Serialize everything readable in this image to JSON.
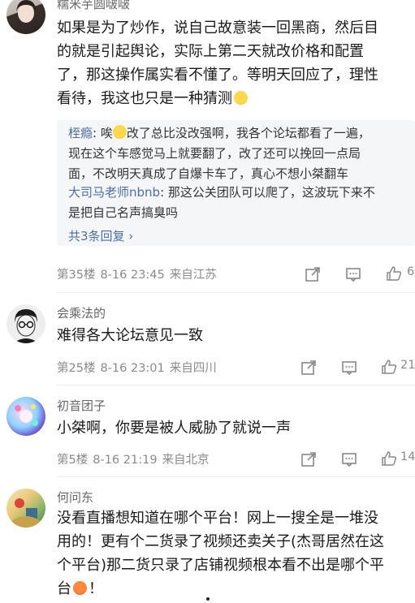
{
  "comments": [
    {
      "username": "糯米芋圆啵啵",
      "body_lines": [
        "如果是为了炒作，说自己故意装一回黑商，然后目",
        "的就是引起舆论，实际上第二天就改价格和配置",
        "了，那这操作属实看不懂了。等明天回应了，理性",
        "看待，我这也只是一种猜测"
      ],
      "replies": [
        {
          "name": "桎瘾",
          "sep": ": ",
          "lines": [
            "唉",
            "改了总比没改强啊，我各个论坛都看了一遍，",
            "现在这个车感觉马上就要翻了，改了还可以挽回一点局",
            "面，不改明天真成了自爆卡车了，真心不想小桀翻车"
          ]
        },
        {
          "name": "大司马老师nbnb",
          "sep": ": ",
          "lines": [
            "那这公关团队可以爬了，这波玩下来不",
            "是把自己名声搞臭吗"
          ]
        }
      ],
      "more_replies": "共3条回复 ›",
      "floor": "第35楼",
      "time": "8-16 23:45",
      "location": "来自江苏",
      "likes": "6"
    },
    {
      "username": "会乘法的",
      "body_lines": [
        "难得各大论坛意见一致"
      ],
      "floor": "第25楼",
      "time": "8-16 23:01",
      "location": "来自四川",
      "likes": "21"
    },
    {
      "username": "初音团子",
      "body_lines": [
        "小桀啊，你要是被人威胁了就说一声"
      ],
      "floor": "第5楼",
      "time": "8-16 21:19",
      "location": "来自北京",
      "likes": "14"
    },
    {
      "username": "何问东",
      "body_lines": [
        "没看直播想知道在哪个平台！网上一搜全是一堆没",
        "用的！更有个二货录了视频还卖关子(杰哥居然在这",
        "个平台)那二货只录了店铺视频根本看不出是哪个平",
        "台",
        "！"
      ]
    }
  ],
  "colors": {
    "accent": "#4a6fa5",
    "meta": "#8a8a8a"
  }
}
